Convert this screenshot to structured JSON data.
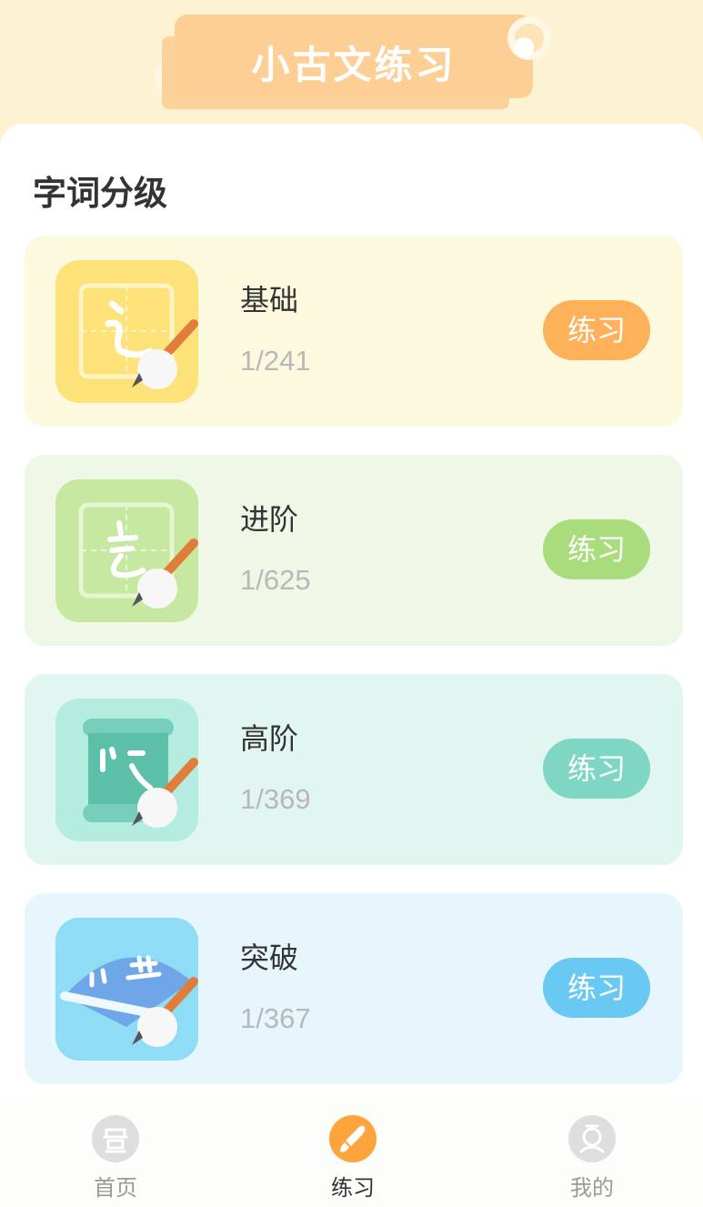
{
  "header": {
    "title": "小古文练习"
  },
  "section": {
    "title": "字词分级"
  },
  "levels": [
    {
      "name": "基础",
      "progress": "1/241",
      "button": "练习",
      "card_color": "#fcf9df",
      "button_color": "#fdb259",
      "icon_color": "#fde27a"
    },
    {
      "name": "进阶",
      "progress": "1/625",
      "button": "练习",
      "card_color": "#eff7e7",
      "button_color": "#a9dc7c",
      "icon_color": "#c6e8a0"
    },
    {
      "name": "高阶",
      "progress": "1/369",
      "button": "练习",
      "card_color": "#e2f6f1",
      "button_color": "#7fd6c3",
      "icon_color": "#b4ece0"
    },
    {
      "name": "突破",
      "progress": "1/367",
      "button": "练习",
      "card_color": "#e7f5fd",
      "button_color": "#6ac9f2",
      "icon_color": "#8fdcf7"
    }
  ],
  "tabs": [
    {
      "label": "首页",
      "icon": "home-icon",
      "active": false
    },
    {
      "label": "练习",
      "icon": "brush-icon",
      "active": true
    },
    {
      "label": "我的",
      "icon": "profile-icon",
      "active": false
    }
  ]
}
